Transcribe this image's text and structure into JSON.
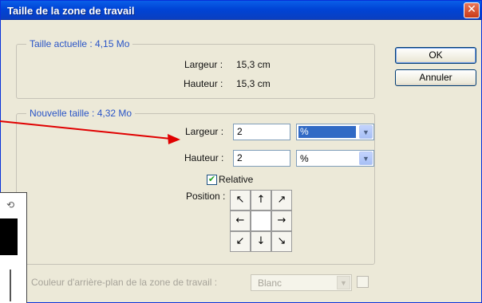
{
  "dialog": {
    "title": "Taille de la zone de travail",
    "close_glyph": "✕"
  },
  "current_size": {
    "legend": "Taille actuelle : 4,15 Mo",
    "width_label": "Largeur :",
    "width_value": "15,3 cm",
    "height_label": "Hauteur :",
    "height_value": "15,3 cm"
  },
  "new_size": {
    "legend": "Nouvelle taille : 4,32 Mo",
    "width_label": "Largeur :",
    "width_value": "2",
    "width_unit": "%",
    "height_label": "Hauteur :",
    "height_value": "2",
    "height_unit": "%",
    "relative_label": "Relative",
    "relative_checked": true,
    "position_label": "Position :",
    "anchor_glyphs": [
      "↖",
      "↑",
      "↗",
      "←",
      "",
      "→",
      "↙",
      "↓",
      "↘"
    ]
  },
  "buttons": {
    "ok": "OK",
    "cancel": "Annuler"
  },
  "canvas_color": {
    "label": "Couleur d'arrière-plan de la zone de travail :",
    "value": "Blanc"
  },
  "icons": {
    "dropdown": "chevron-down-icon",
    "checkmark": "✔",
    "annotation": "red-arrow"
  },
  "colors": {
    "title_bar": "#0a4fe0",
    "legend_text": "#2a55c7",
    "highlight": "#316ac5",
    "annotation_arrow": "#e00000"
  }
}
